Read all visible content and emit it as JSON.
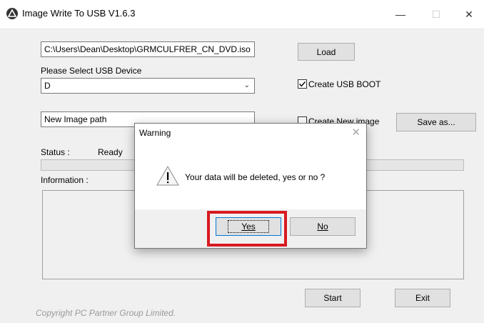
{
  "window": {
    "title": "Image Write To USB  V1.6.3",
    "minimize_glyph": "—",
    "maximize_glyph": "☐",
    "close_glyph": "✕"
  },
  "form": {
    "iso_path_value": "C:\\Users\\Dean\\Desktop\\GRMCULFRER_CN_DVD.iso",
    "load_label": "Load",
    "select_usb_label": "Please Select USB Device",
    "usb_device_value": "D",
    "create_usb_boot_label": "Create USB BOOT",
    "create_usb_boot_checked": true,
    "new_image_path_value": "New Image path",
    "create_new_image_label": "Create New image",
    "create_new_image_checked": false,
    "save_as_label": "Save as...",
    "status_label": "Status :",
    "status_value": "Ready",
    "information_label": "Information :",
    "start_label": "Start",
    "exit_label": "Exit",
    "copyright": "Copyright PC Partner Group Limited."
  },
  "dialog": {
    "title": "Warning",
    "close_glyph": "✕",
    "message": "Your data will be deleted, yes or no ?",
    "yes_label": "Yes",
    "no_label": "No",
    "icon": "warning-icon"
  },
  "colors": {
    "highlight": "#d81a21",
    "focus_border": "#0078d7"
  }
}
